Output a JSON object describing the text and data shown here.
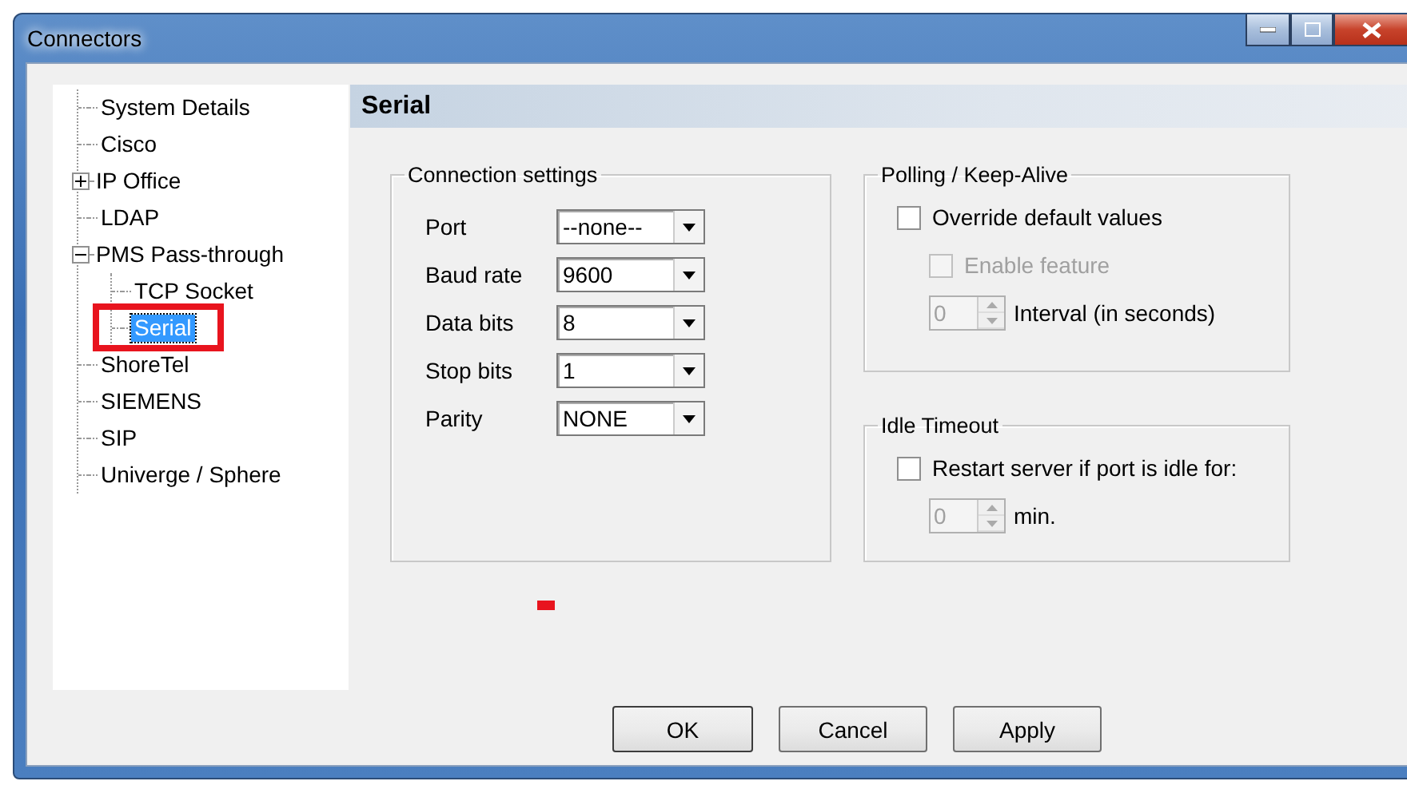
{
  "window": {
    "title": "Connectors"
  },
  "tree": [
    {
      "label": "System Details",
      "selected": false
    },
    {
      "label": "Cisco",
      "selected": false
    },
    {
      "label": "IP Office",
      "expanded": false,
      "selected": false
    },
    {
      "label": "LDAP",
      "selected": false
    },
    {
      "label": "PMS Pass-through",
      "expanded": true,
      "selected": false,
      "children": [
        {
          "label": "TCP Socket",
          "selected": false
        },
        {
          "label": "Serial",
          "selected": true,
          "highlighted": true
        }
      ]
    },
    {
      "label": "ShoreTel",
      "selected": false
    },
    {
      "label": "SIEMENS",
      "selected": false
    },
    {
      "label": "SIP",
      "selected": false
    },
    {
      "label": "Univerge / Sphere",
      "selected": false
    }
  ],
  "page_title": "Serial",
  "connection_settings": {
    "title": "Connection settings",
    "fields": [
      {
        "label": "Port",
        "value": "--none--"
      },
      {
        "label": "Baud rate",
        "value": "9600"
      },
      {
        "label": "Data bits",
        "value": "8"
      },
      {
        "label": "Stop bits",
        "value": "1"
      },
      {
        "label": "Parity",
        "value": "NONE"
      }
    ]
  },
  "polling": {
    "title": "Polling / Keep-Alive",
    "override": {
      "label": "Override default values",
      "checked": false,
      "disabled": false
    },
    "enable": {
      "label": "Enable feature",
      "checked": false,
      "disabled": true
    },
    "interval": {
      "value": "0",
      "label": "Interval (in seconds)",
      "disabled": true
    }
  },
  "idle_timeout": {
    "title": "Idle Timeout",
    "restart": {
      "label": "Restart server if port is idle for:",
      "checked": false,
      "disabled": false
    },
    "minutes": {
      "value": "0",
      "label": "min.",
      "disabled": true
    }
  },
  "buttons": [
    "OK",
    "Cancel",
    "Apply"
  ]
}
